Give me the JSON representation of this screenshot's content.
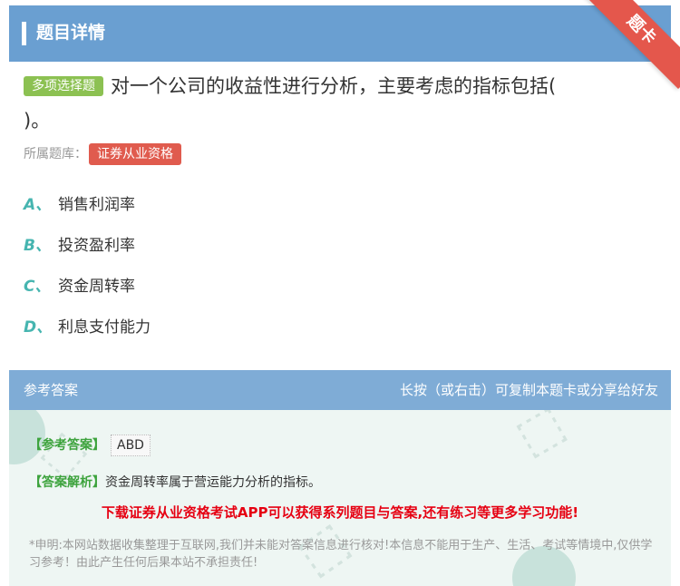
{
  "header": {
    "title": "题目详情",
    "ribbon_label": "题卡"
  },
  "question": {
    "type_badge": "多项选择题",
    "text_line1": "对一个公司的收益性进行分析，主要考虑的指标包括(",
    "text_line2": ")。",
    "library_label": "所属题库：",
    "library_tag": "证券从业资格"
  },
  "options": [
    {
      "letter": "A、",
      "text": "销售利润率"
    },
    {
      "letter": "B、",
      "text": "投资盈利率"
    },
    {
      "letter": "C、",
      "text": "资金周转率"
    },
    {
      "letter": "D、",
      "text": "利息支付能力"
    }
  ],
  "answer_section": {
    "header_left": "参考答案",
    "header_right": "长按（或右击）可复制本题卡或分享给好友",
    "answer_label": "【参考答案】",
    "answer_value": "ABD",
    "analysis_label": "【答案解析】",
    "analysis_text": "资金周转率属于营运能力分析的指标。",
    "promo_text": "下载证券从业资格考试APP可以获得系列题目与答案,还有练习等更多学习功能!",
    "disclaimer": "*申明:本网站数据收集整理于互联网,我们并未能对答案信息进行核对!本信息不能用于生产、生活、考试等情境中,仅供学习参考！由此产生任何后果本站不承担责任!"
  },
  "colors": {
    "header_bg": "#6a9fd1",
    "ribbon": "#e4574c",
    "type_badge": "#8cc152",
    "library_tag": "#e05b4e",
    "option_letter": "#46b5b0",
    "answer_label": "#3da33d",
    "promo": "#e60012"
  }
}
